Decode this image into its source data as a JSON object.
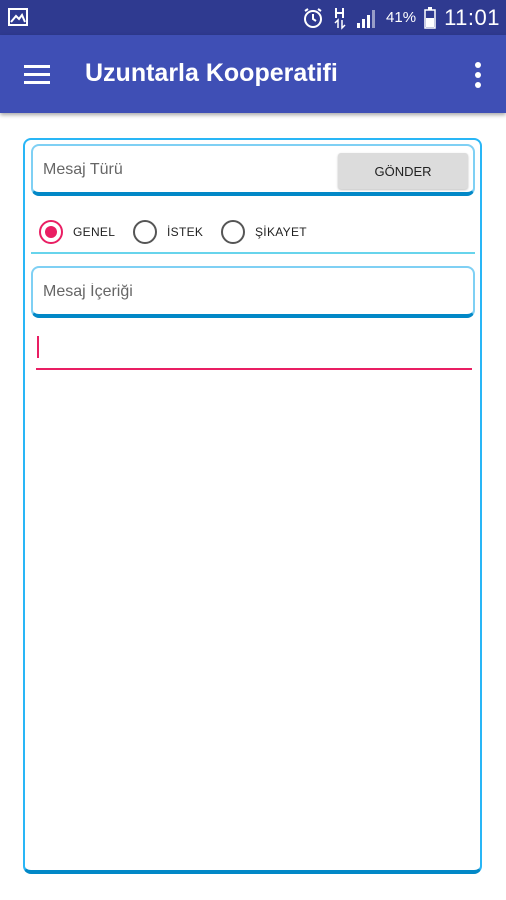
{
  "status_bar": {
    "icons": [
      "gallery-icon",
      "alarm-icon",
      "data-icon",
      "signal-icon",
      "battery-icon"
    ],
    "battery_percent": "41%",
    "time": "11:01"
  },
  "app_bar": {
    "title": "Uzuntarla Kooperatifi",
    "menu_icon": "hamburger-menu-icon",
    "more_icon": "more-vert-icon"
  },
  "form": {
    "message_type": {
      "value": "",
      "placeholder": "Mesaj Türü"
    },
    "send_button_label": "GÖNDER",
    "radio_options": [
      {
        "label": "GENEL",
        "checked": true
      },
      {
        "label": "İSTEK",
        "checked": false
      },
      {
        "label": "ŞİKAYET",
        "checked": false
      }
    ],
    "message_content": {
      "value": "",
      "placeholder": "Mesaj İçeriği"
    }
  },
  "colors": {
    "status_bar": "#2f3a90",
    "app_bar": "#3f4fb5",
    "accent": "#e91e63",
    "border": "#29b6f6"
  }
}
